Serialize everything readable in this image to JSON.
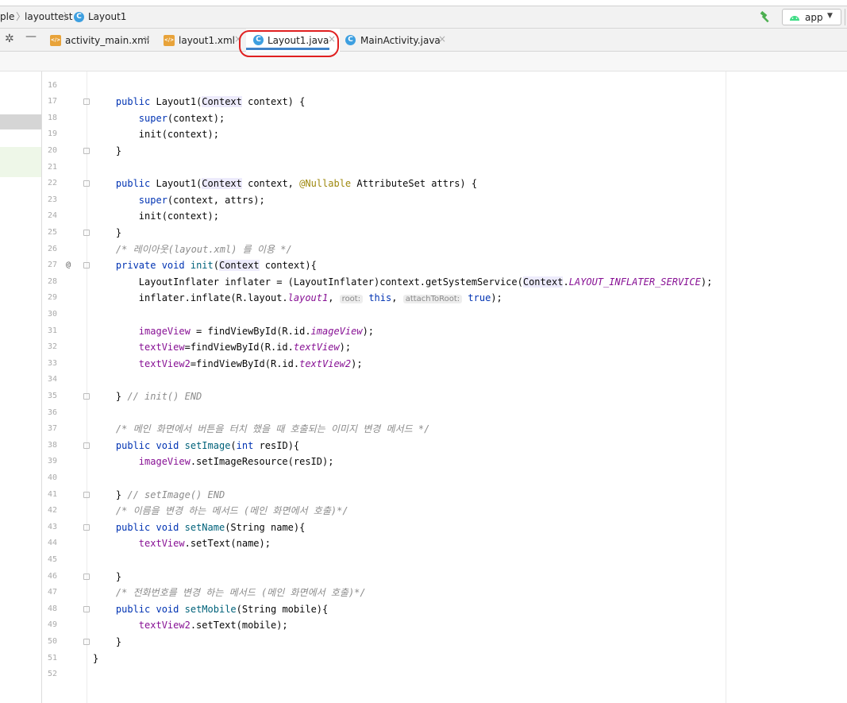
{
  "breadcrumb": {
    "items": [
      "ple",
      "layouttest",
      "Layout1"
    ]
  },
  "toolbar": {
    "run_config": "app"
  },
  "tabs": [
    {
      "label": "activity_main.xml",
      "type": "xml"
    },
    {
      "label": "layout1.xml",
      "type": "xml"
    },
    {
      "label": "Layout1.java",
      "type": "class",
      "active": true
    },
    {
      "label": "MainActivity.java",
      "type": "class"
    }
  ],
  "editor": {
    "line_numbers": [
      "16",
      "17",
      "18",
      "19",
      "20",
      "21",
      "22",
      "23",
      "24",
      "25",
      "26",
      "27",
      "28",
      "29",
      "30",
      "31",
      "32",
      "33",
      "34",
      "35",
      "36",
      "37",
      "38",
      "39",
      "40",
      "41",
      "42",
      "43",
      "44",
      "45",
      "46",
      "47",
      "48",
      "49",
      "50",
      "51",
      "52"
    ],
    "gutter_marker": "@",
    "lines": [
      [],
      [
        {
          "t": "    "
        },
        {
          "t": "public",
          "c": "kw"
        },
        {
          "t": " Layout1("
        },
        {
          "t": "Context",
          "c": "hl"
        },
        {
          "t": " context) {"
        }
      ],
      [
        {
          "t": "        "
        },
        {
          "t": "super",
          "c": "kw"
        },
        {
          "t": "(context);"
        }
      ],
      [
        {
          "t": "        init(context);"
        }
      ],
      [
        {
          "t": "    }"
        }
      ],
      [],
      [
        {
          "t": "    "
        },
        {
          "t": "public",
          "c": "kw"
        },
        {
          "t": " Layout1("
        },
        {
          "t": "Context",
          "c": "hl"
        },
        {
          "t": " context, "
        },
        {
          "t": "@Nullable",
          "c": "ann"
        },
        {
          "t": " AttributeSet attrs) {"
        }
      ],
      [
        {
          "t": "        "
        },
        {
          "t": "super",
          "c": "kw"
        },
        {
          "t": "(context, attrs);"
        }
      ],
      [
        {
          "t": "        init(context);"
        }
      ],
      [
        {
          "t": "    }"
        }
      ],
      [
        {
          "t": "    "
        },
        {
          "t": "/* 레이아웃(layout.xml) 를 이용 */",
          "c": "cm"
        }
      ],
      [
        {
          "t": "    "
        },
        {
          "t": "private void",
          "c": "kw"
        },
        {
          "t": " "
        },
        {
          "t": "init",
          "c": "fn"
        },
        {
          "t": "("
        },
        {
          "t": "Context",
          "c": "hl"
        },
        {
          "t": " context){"
        }
      ],
      [
        {
          "t": "        LayoutInflater inflater = (LayoutInflater)context.getSystemService("
        },
        {
          "t": "Context",
          "c": "hl"
        },
        {
          "t": "."
        },
        {
          "t": "LAYOUT_INFLATER_SERVICE",
          "c": "fld it"
        },
        {
          "t": ");"
        }
      ],
      [
        {
          "t": "        inflater.inflate(R.layout."
        },
        {
          "t": "layout1",
          "c": "fld it"
        },
        {
          "t": ", "
        },
        {
          "t": "root:",
          "c": "hint"
        },
        {
          "t": " "
        },
        {
          "t": "this",
          "c": "kw"
        },
        {
          "t": ", "
        },
        {
          "t": "attachToRoot:",
          "c": "hint"
        },
        {
          "t": " "
        },
        {
          "t": "true",
          "c": "kw"
        },
        {
          "t": ");"
        }
      ],
      [],
      [
        {
          "t": "        "
        },
        {
          "t": "imageView",
          "c": "fld"
        },
        {
          "t": " = findViewById(R.id."
        },
        {
          "t": "imageView",
          "c": "fld it"
        },
        {
          "t": ");"
        }
      ],
      [
        {
          "t": "        "
        },
        {
          "t": "textView",
          "c": "fld"
        },
        {
          "t": "=findViewById(R.id."
        },
        {
          "t": "textView",
          "c": "fld it"
        },
        {
          "t": ");"
        }
      ],
      [
        {
          "t": "        "
        },
        {
          "t": "textView2",
          "c": "fld"
        },
        {
          "t": "=findViewById(R.id."
        },
        {
          "t": "textView2",
          "c": "fld it"
        },
        {
          "t": ");"
        }
      ],
      [],
      [
        {
          "t": "    } "
        },
        {
          "t": "// init() END",
          "c": "cm"
        }
      ],
      [],
      [
        {
          "t": "    "
        },
        {
          "t": "/* 메인 화면에서 버튼을 터치 했을 때 호출되는 이미지 변경 메서드 */",
          "c": "cm"
        }
      ],
      [
        {
          "t": "    "
        },
        {
          "t": "public void",
          "c": "kw"
        },
        {
          "t": " "
        },
        {
          "t": "setImage",
          "c": "fn"
        },
        {
          "t": "("
        },
        {
          "t": "int",
          "c": "kw"
        },
        {
          "t": " resID){"
        }
      ],
      [
        {
          "t": "        "
        },
        {
          "t": "imageView",
          "c": "fld"
        },
        {
          "t": ".setImageResource(resID);"
        }
      ],
      [],
      [
        {
          "t": "    } "
        },
        {
          "t": "// setImage() END",
          "c": "cm"
        }
      ],
      [
        {
          "t": "    "
        },
        {
          "t": "/* 이름을 변경 하는 메서드 (메인 화면에서 호출)*/",
          "c": "cm"
        }
      ],
      [
        {
          "t": "    "
        },
        {
          "t": "public void",
          "c": "kw"
        },
        {
          "t": " "
        },
        {
          "t": "setName",
          "c": "fn"
        },
        {
          "t": "(String name){"
        }
      ],
      [
        {
          "t": "        "
        },
        {
          "t": "textView",
          "c": "fld"
        },
        {
          "t": ".setText(name);"
        }
      ],
      [],
      [
        {
          "t": "    }"
        }
      ],
      [
        {
          "t": "    "
        },
        {
          "t": "/* 전화번호를 변경 하는 메서드 (메인 화면에서 호출)*/",
          "c": "cm"
        }
      ],
      [
        {
          "t": "    "
        },
        {
          "t": "public void",
          "c": "kw"
        },
        {
          "t": " "
        },
        {
          "t": "setMobile",
          "c": "fn"
        },
        {
          "t": "(String mobile){"
        }
      ],
      [
        {
          "t": "        "
        },
        {
          "t": "textView2",
          "c": "fld"
        },
        {
          "t": ".setText(mobile);"
        }
      ],
      [
        {
          "t": "    }"
        }
      ],
      [
        {
          "t": "}"
        }
      ],
      []
    ]
  },
  "colors": {
    "keyword": "#0033b3",
    "method": "#00627a",
    "field": "#871094",
    "comment": "#8c8c8c",
    "annotation": "#9e880d",
    "active_tab_underline": "#4083c9",
    "highlight_circle": "#e02020"
  },
  "icons": [
    "class-icon",
    "xml-file-icon",
    "gear-icon",
    "hammer-icon",
    "android-icon",
    "chevron-down-icon",
    "close-icon"
  ]
}
